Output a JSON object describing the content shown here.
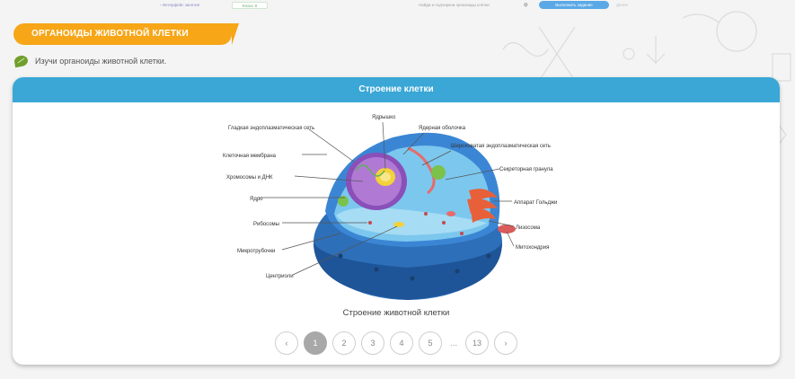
{
  "topbar": {
    "back": "‹ Интерфейс занятия",
    "level": "Класс 8",
    "choose": "Найди и подчеркни органоиды клетки",
    "choose_icon": "⓿",
    "cta": "Выполнить задание",
    "next": "Далее"
  },
  "section": {
    "title": "ОРГАНОИДЫ ЖИВОТНОЙ КЛЕТКИ",
    "instruction": "Изучи органоиды животной клетки."
  },
  "card": {
    "header": "Строение клетки",
    "caption": "Строение животной клетки"
  },
  "diagram_labels": {
    "smooth_er": "Гладкая эндоплазматическая сеть",
    "nucleolus": "Ядрышко",
    "nuclear_envelope": "Ядерная оболочка",
    "rough_er": "Шероховатая эндоплазматическая сеть",
    "cell_membrane": "Клеточная мембрана",
    "secretory_granule": "Секреторная гранула",
    "chromosomes": "Хромосомы и ДНК",
    "nucleus": "Ядро",
    "golgi": "Аппарат Гольджи",
    "ribosomes": "Рибосомы",
    "lysosome": "Лизосома",
    "microtubules": "Микротрубочки",
    "mitochondria": "Митохондрия",
    "centrioles": "Центриоли"
  },
  "pagination": {
    "prev": "‹",
    "pages": [
      "1",
      "2",
      "3",
      "4",
      "5"
    ],
    "dots": "...",
    "last": "13",
    "next": "›",
    "current": "1"
  },
  "colors": {
    "banner": "#f6a617",
    "card_header": "#3aa7d6",
    "cta": "#5aa9e6",
    "leaf": "#6f9f2d"
  }
}
